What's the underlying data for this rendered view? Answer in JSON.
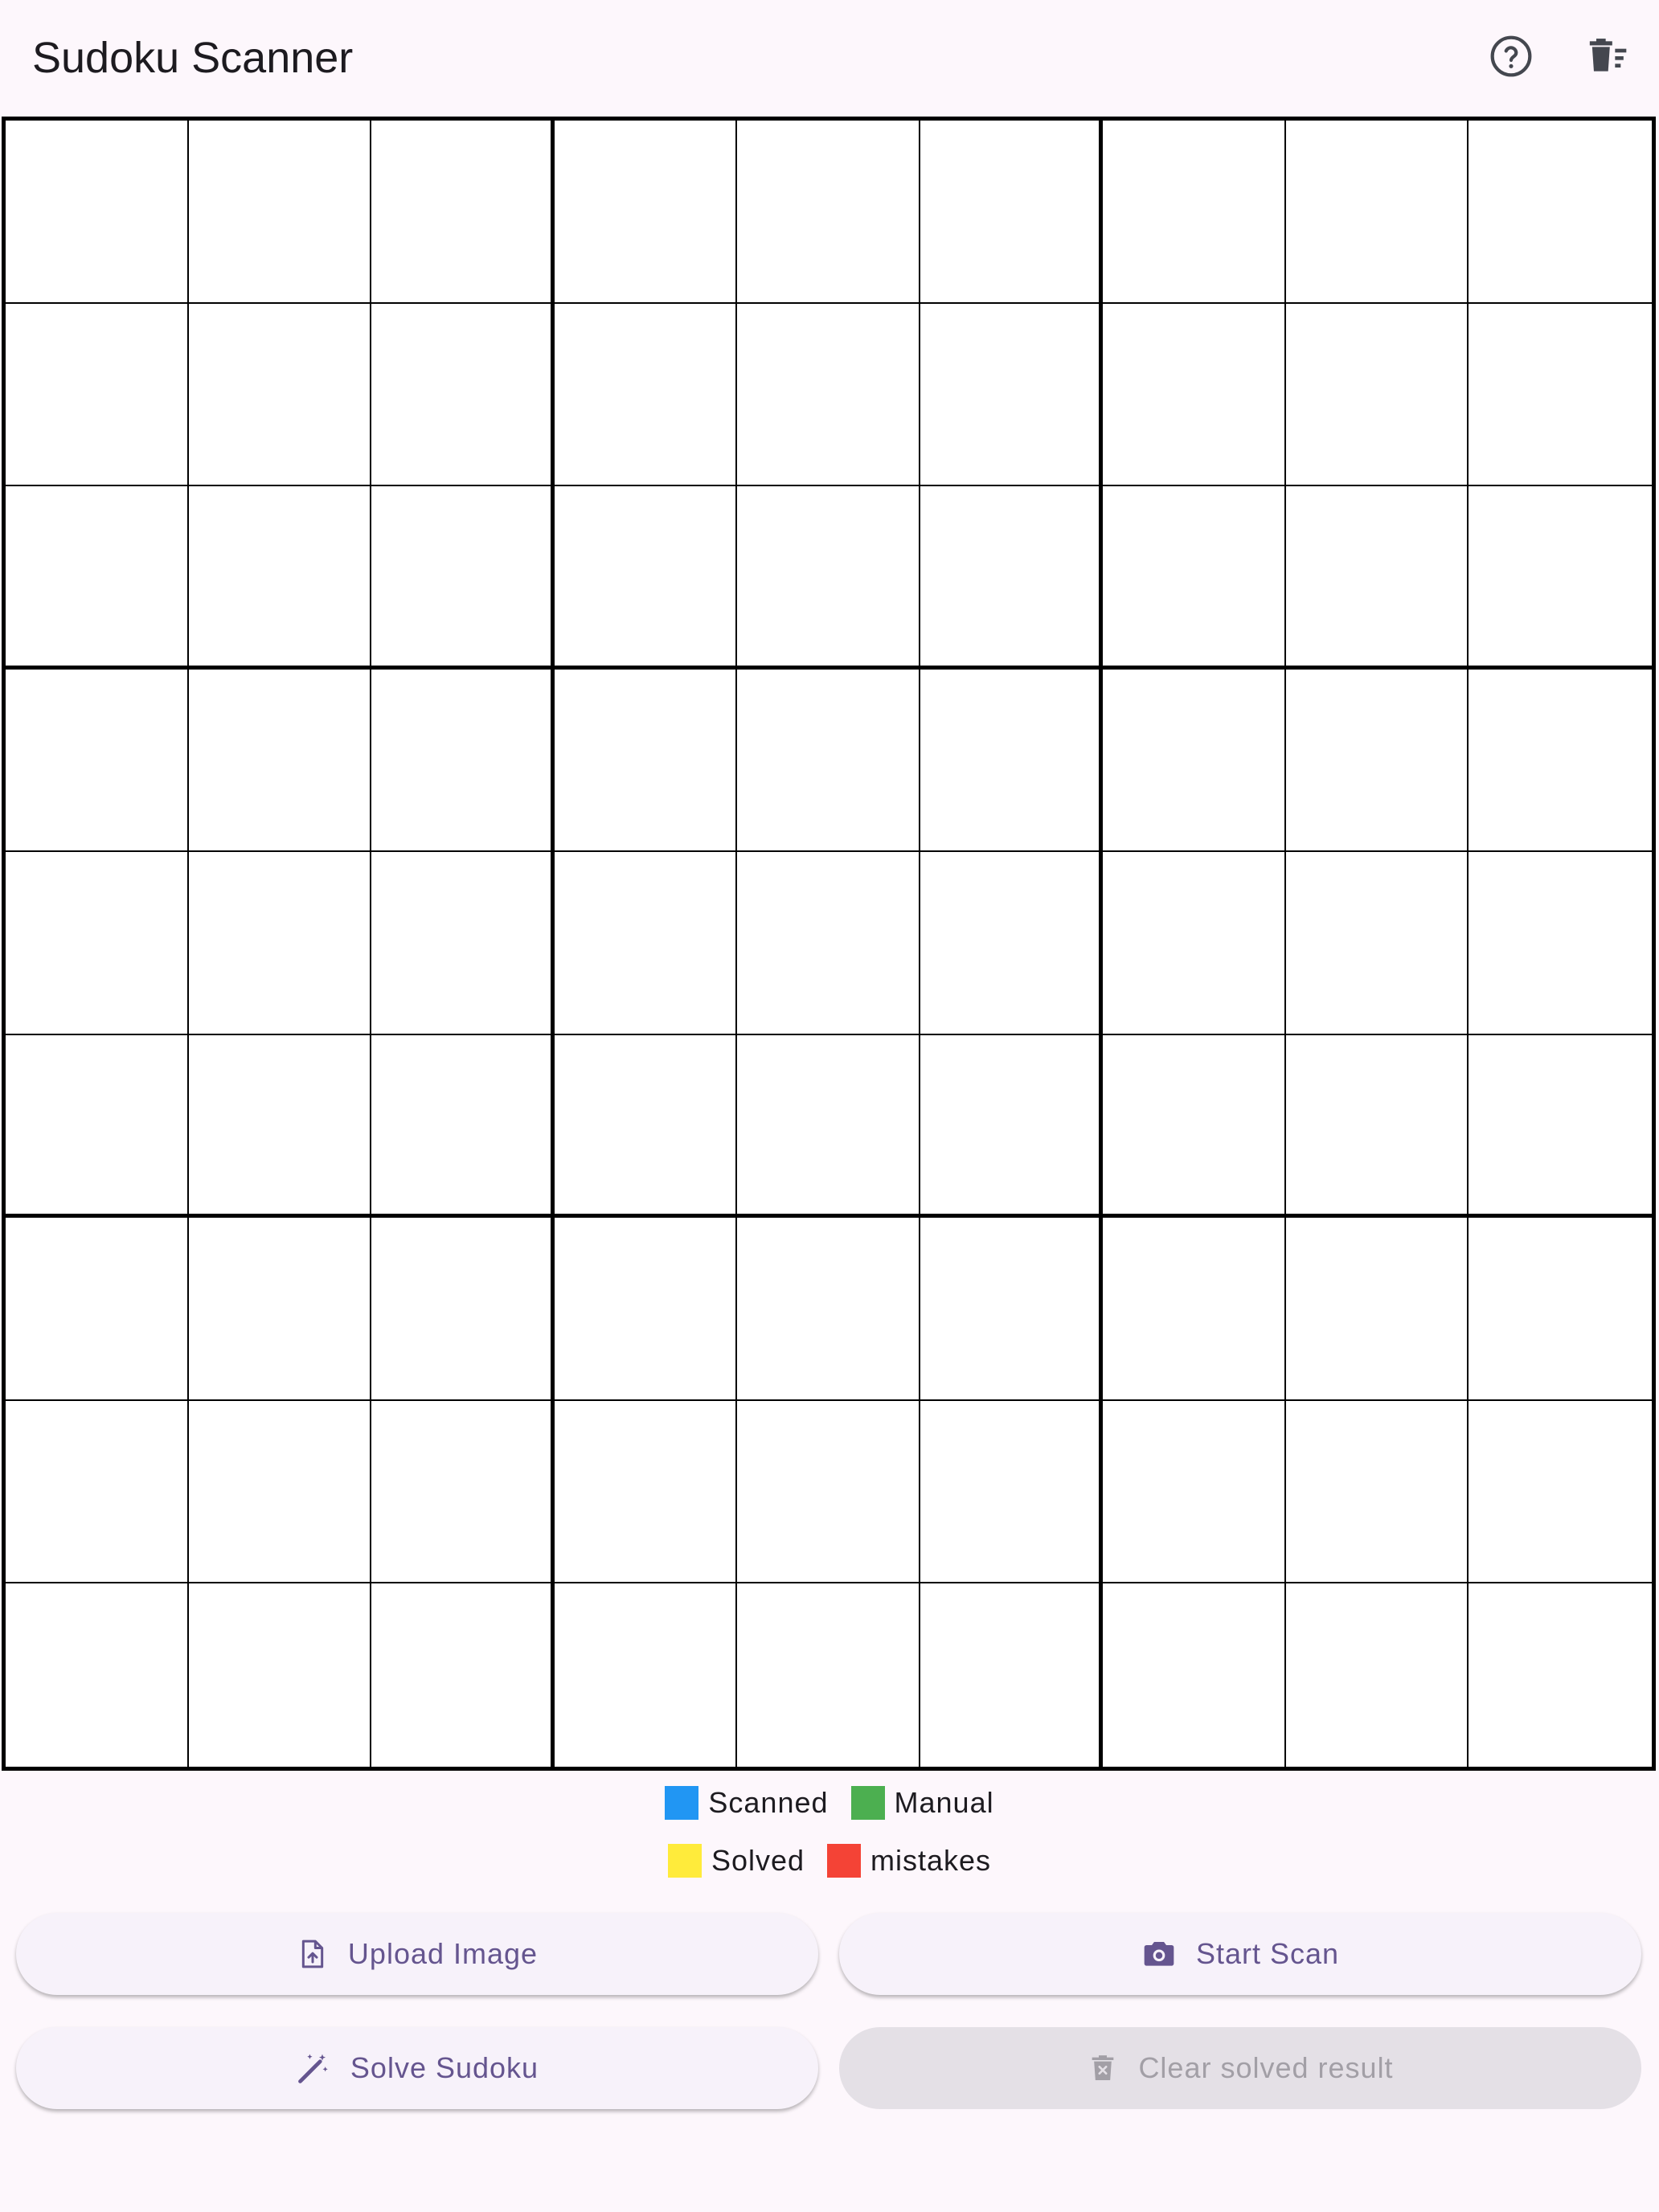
{
  "app": {
    "title": "Sudoku Scanner"
  },
  "appbar": {
    "actions": [
      {
        "name": "help",
        "icon": "help-circle-icon"
      },
      {
        "name": "clear-all",
        "icon": "delete-sweep-icon"
      }
    ]
  },
  "board": {
    "size": 9,
    "cells": [
      [
        "",
        "",
        "",
        "",
        "",
        "",
        "",
        "",
        ""
      ],
      [
        "",
        "",
        "",
        "",
        "",
        "",
        "",
        "",
        ""
      ],
      [
        "",
        "",
        "",
        "",
        "",
        "",
        "",
        "",
        ""
      ],
      [
        "",
        "",
        "",
        "",
        "",
        "",
        "",
        "",
        ""
      ],
      [
        "",
        "",
        "",
        "",
        "",
        "",
        "",
        "",
        ""
      ],
      [
        "",
        "",
        "",
        "",
        "",
        "",
        "",
        "",
        ""
      ],
      [
        "",
        "",
        "",
        "",
        "",
        "",
        "",
        "",
        ""
      ],
      [
        "",
        "",
        "",
        "",
        "",
        "",
        "",
        "",
        ""
      ],
      [
        "",
        "",
        "",
        "",
        "",
        "",
        "",
        "",
        ""
      ]
    ]
  },
  "legend": {
    "rows": [
      [
        {
          "label": "Scanned",
          "color": "#2196f3"
        },
        {
          "label": "Manual",
          "color": "#4caf50"
        }
      ],
      [
        {
          "label": "Solved",
          "color": "#ffeb3b"
        },
        {
          "label": "mistakes",
          "color": "#f44336"
        }
      ]
    ]
  },
  "buttons": {
    "upload_image": {
      "label": "Upload Image",
      "icon": "upload-file-icon"
    },
    "start_scan": {
      "label": "Start Scan",
      "icon": "camera-icon"
    },
    "solve_sudoku": {
      "label": "Solve Sudoku",
      "icon": "magic-wand-icon"
    },
    "clear_solved": {
      "label": "Clear solved result",
      "icon": "delete-icon",
      "disabled": true
    }
  },
  "colors": {
    "background": "#fdf7fc",
    "accent": "#65558f",
    "button_bg": "#f7f2fa",
    "button_disabled_bg": "#e4e0e6",
    "button_disabled_text": "#a29fa6",
    "grid_line": "#000000"
  }
}
